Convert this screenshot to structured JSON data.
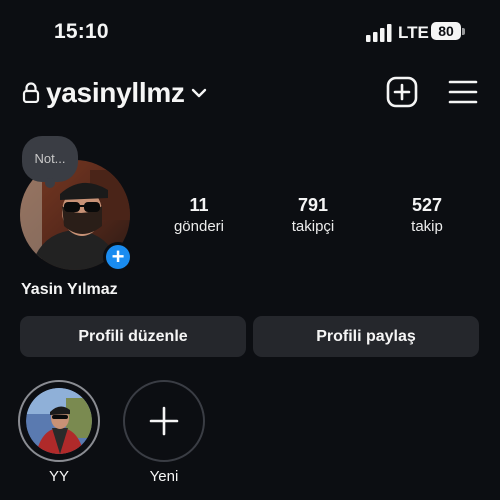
{
  "status_bar": {
    "time": "15:10",
    "network": "LTE",
    "battery": "80"
  },
  "header": {
    "username": "yasinyllmz",
    "icons": [
      "lock-icon",
      "chevron-down-icon",
      "add-square-icon",
      "menu-icon"
    ]
  },
  "profile": {
    "note_text": "Not...",
    "full_name": "Yasin Yılmaz",
    "stats": [
      {
        "value": "11",
        "label": "gönderi"
      },
      {
        "value": "791",
        "label": "takipçi"
      },
      {
        "value": "527",
        "label": "takip"
      }
    ]
  },
  "actions": {
    "edit_label": "Profili düzenle",
    "share_label": "Profili paylaş"
  },
  "highlights": [
    {
      "label": "YY"
    },
    {
      "label": "Yeni"
    }
  ],
  "colors": {
    "background": "#0c0e12",
    "button_bg": "#25272c",
    "accent_blue": "#1a8cf0",
    "text": "#f5f5f5"
  }
}
